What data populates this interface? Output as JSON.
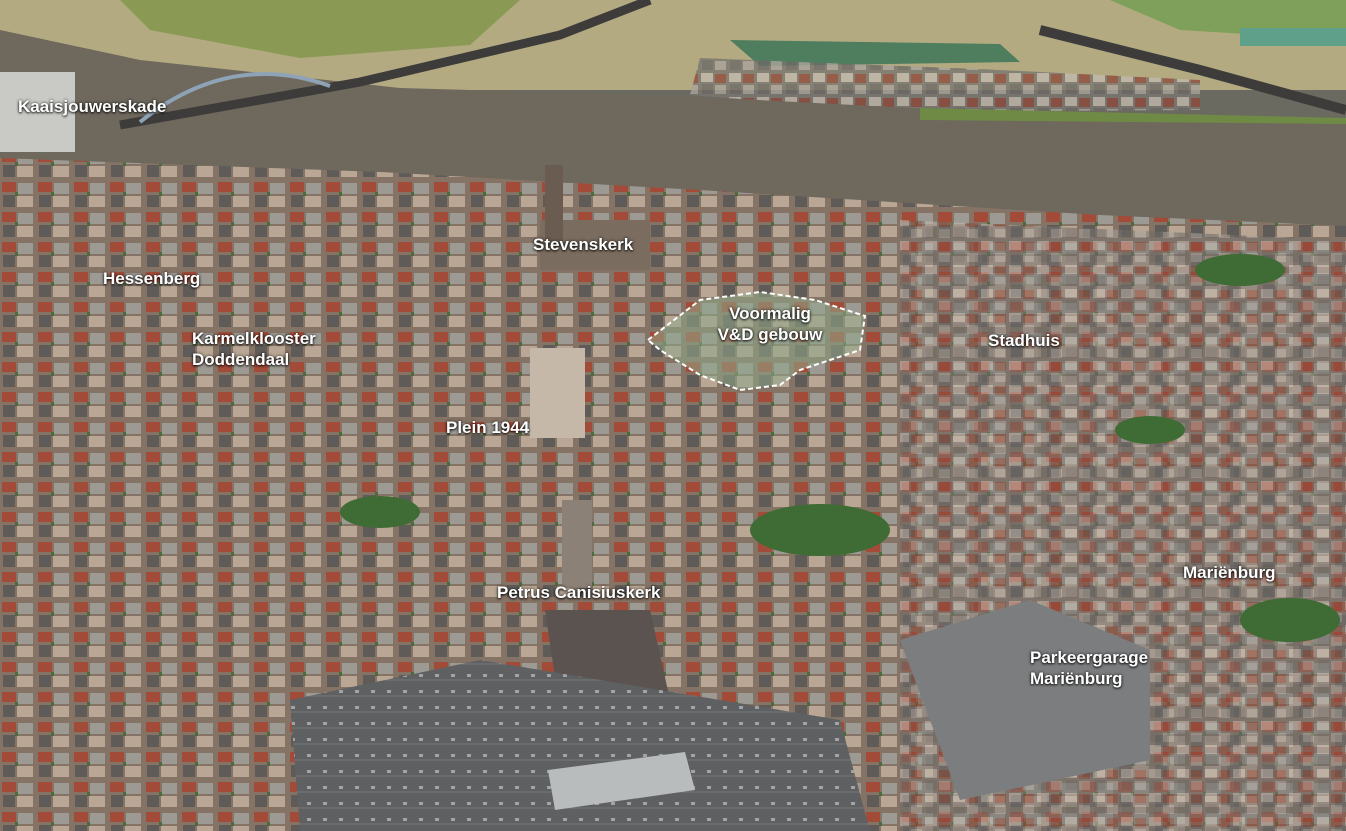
{
  "map": {
    "labels": {
      "kaaisjouwerskade": "Kaaisjouwerskade",
      "stevenskerk": "Stevenskerk",
      "hessenberg": "Hessenberg",
      "karmelklooster_line1": "Karmelklooster",
      "karmelklooster_line2": "Doddendaal",
      "voormalig_line1": "Voormalig",
      "voormalig_line2": "V&D gebouw",
      "stadhuis": "Stadhuis",
      "plein1944": "Plein 1944",
      "petrus": "Petrus Canisiuskerk",
      "marienburg": "Mariënburg",
      "parkeergarage_line1": "Parkeergarage",
      "parkeergarage_line2": "Mariënburg"
    },
    "highlight": {
      "name": "Voormalig V&D gebouw",
      "outline_color": "#ffffff"
    },
    "colors": {
      "river": "#6e685d",
      "floodplain": "#b7ae85",
      "grass": "#7c9a52",
      "roofs": "#8c7466",
      "parking": "#6a6a68"
    }
  }
}
